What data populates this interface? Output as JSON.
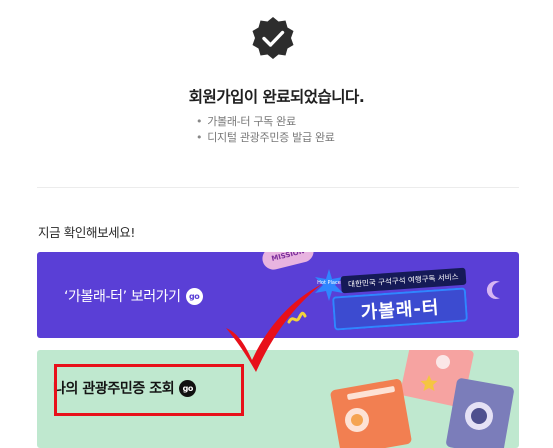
{
  "completion": {
    "title": "회원가입이 완료되었습니다.",
    "bullets": [
      "가볼래-터 구독 완료",
      "디지털 관광주민증 발급 완료"
    ]
  },
  "section_label": "지금 확인해보세요!",
  "cards": [
    {
      "label": "‘가볼래-터’ 보러가기",
      "go": "go",
      "mission_tag": "MISSION",
      "brand_sub": "대한민국 구석구석 여행구독 서비스",
      "brand_title": "가볼래-터",
      "star_text": "Hot Place"
    },
    {
      "label": "나의 관광주민증 조회",
      "go": "go"
    }
  ],
  "colors": {
    "purple_card": "#5a3fd6",
    "mint_card": "#bfe8cf",
    "highlight": "#e8101a",
    "badge": "#2d2d2d"
  }
}
